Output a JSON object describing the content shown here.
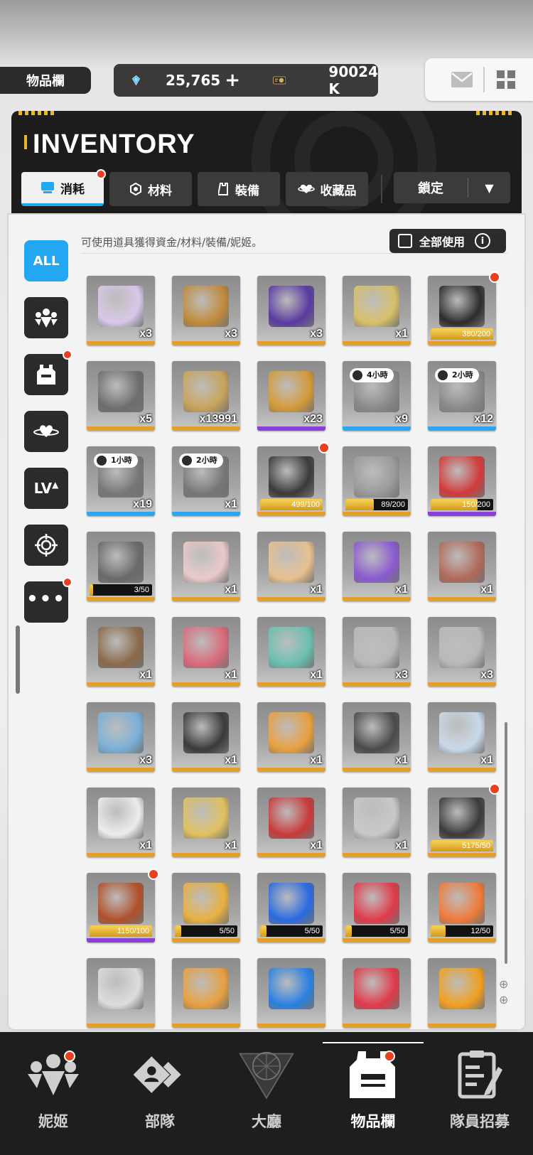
{
  "header": {
    "title": "物品欄",
    "gems": "25,765",
    "plus": "+",
    "credits": "90024 K"
  },
  "inventory": {
    "title": "INVENTORY",
    "tabs": [
      {
        "label": "消耗",
        "active": true,
        "badge": true
      },
      {
        "label": "材料",
        "active": false,
        "badge": false
      },
      {
        "label": "裝備",
        "active": false,
        "badge": false
      },
      {
        "label": "收藏品",
        "active": false,
        "badge": false
      }
    ],
    "lock_label": "鎖定"
  },
  "content": {
    "hint": "可使用道具獲得資金/材料/裝備/妮姬。",
    "use_all": "全部使用",
    "all_label": "ALL",
    "lv_label": "LV"
  },
  "items": [
    {
      "qty": "x3",
      "color": "#e3a02a",
      "art": "#d8c7e8"
    },
    {
      "qty": "x3",
      "color": "#e3a02a",
      "art": "#c08a3a"
    },
    {
      "qty": "x3",
      "color": "#e3a02a",
      "art": "#5a3aa0"
    },
    {
      "qty": "x1",
      "color": "#e3a02a",
      "art": "#d7bf6a"
    },
    {
      "progress": "380/200",
      "fill": 1.0,
      "color": "#e3a02a",
      "art": "#2c2c2c",
      "badge": true
    },
    {
      "qty": "x5",
      "color": "#e3a02a",
      "art": "#6e6e6e"
    },
    {
      "qty": "x13991",
      "color": "#e3a02a",
      "art": "#c9a35a"
    },
    {
      "qty": "x23",
      "color": "#8b3fd9",
      "art": "#d39a3a"
    },
    {
      "qty": "x9",
      "color": "#2aa7ef",
      "art": "#8a8a8a",
      "tag": "4小時"
    },
    {
      "qty": "x12",
      "color": "#2aa7ef",
      "art": "#8a8a8a",
      "tag": "2小時"
    },
    {
      "qty": "x19",
      "color": "#2aa7ef",
      "art": "#777",
      "tag": "1小時"
    },
    {
      "qty": "x1",
      "color": "#2aa7ef",
      "art": "#777",
      "tag": "2小時"
    },
    {
      "progress": "499/100",
      "fill": 1.0,
      "color": "#e3a02a",
      "art": "#3a3a3a",
      "badge": true
    },
    {
      "progress": "89/200",
      "fill": 0.45,
      "color": "#e3a02a",
      "art": "#9a9a9a"
    },
    {
      "progress": "150/200",
      "fill": 0.75,
      "color": "#8b3fd9",
      "art": "#d23a3a"
    },
    {
      "progress": "3/50",
      "fill": 0.06,
      "color": "#e3a02a",
      "art": "#6a6a6a"
    },
    {
      "qty": "x1",
      "color": "#e3a02a",
      "art": "#e9c9c9"
    },
    {
      "qty": "x1",
      "color": "#e3a02a",
      "art": "#e8c090"
    },
    {
      "qty": "x1",
      "color": "#e3a02a",
      "art": "#8a5ad0"
    },
    {
      "qty": "x1",
      "color": "#e3a02a",
      "art": "#b06a5a"
    },
    {
      "qty": "x1",
      "color": "#e3a02a",
      "art": "#8a6a4a"
    },
    {
      "qty": "x1",
      "color": "#e3a02a",
      "art": "#d96a7a"
    },
    {
      "qty": "x1",
      "color": "#e3a02a",
      "art": "#6ac0b0"
    },
    {
      "qty": "x3",
      "color": "#e3a02a",
      "art": "#b8b8b8"
    },
    {
      "qty": "x3",
      "color": "#e3a02a",
      "art": "#b8b8b8"
    },
    {
      "qty": "x3",
      "color": "#e3a02a",
      "art": "#7ab0d8"
    },
    {
      "qty": "x1",
      "color": "#e3a02a",
      "art": "#3a3a3a"
    },
    {
      "qty": "x1",
      "color": "#e3a02a",
      "art": "#e8a040"
    },
    {
      "qty": "x1",
      "color": "#e3a02a",
      "art": "#4a4a4a"
    },
    {
      "qty": "x1",
      "color": "#e3a02a",
      "art": "#c8d8e8"
    },
    {
      "qty": "x1",
      "color": "#e3a02a",
      "art": "#ececec"
    },
    {
      "qty": "x1",
      "color": "#e3a02a",
      "art": "#e0c060"
    },
    {
      "qty": "x1",
      "color": "#e3a02a",
      "art": "#c83a3a"
    },
    {
      "qty": "x1",
      "color": "#e3a02a",
      "art": "#c8c8c8"
    },
    {
      "progress": "5175/50",
      "fill": 1.0,
      "color": "#e3a02a",
      "art": "#3a3a3a",
      "badge": true
    },
    {
      "progress": "1150/100",
      "fill": 1.0,
      "color": "#8b3fd9",
      "art": "#b0502a",
      "badge": true
    },
    {
      "progress": "5/50",
      "fill": 0.1,
      "color": "#e3a02a",
      "art": "#e8b040"
    },
    {
      "progress": "5/50",
      "fill": 0.1,
      "color": "#e3a02a",
      "art": "#2a6ae0"
    },
    {
      "progress": "5/50",
      "fill": 0.1,
      "color": "#e3a02a",
      "art": "#e03a4a"
    },
    {
      "progress": "12/50",
      "fill": 0.24,
      "color": "#e3a02a",
      "art": "#f07a3a"
    },
    {
      "qty": "",
      "color": "#e3a02a",
      "art": "#dcdcdc"
    },
    {
      "qty": "",
      "color": "#e3a02a",
      "art": "#e8a040"
    },
    {
      "qty": "",
      "color": "#e3a02a",
      "art": "#2a80e0"
    },
    {
      "qty": "",
      "color": "#e3a02a",
      "art": "#e03a4a"
    },
    {
      "qty": "",
      "color": "#e3a02a",
      "art": "#f0a020"
    }
  ],
  "bottom_nav": [
    {
      "label": "妮姬",
      "badge": true,
      "active": false,
      "icon": "nikke-icon"
    },
    {
      "label": "部隊",
      "badge": false,
      "active": false,
      "icon": "squad-icon"
    },
    {
      "label": "大廳",
      "badge": false,
      "active": false,
      "icon": "lobby-icon"
    },
    {
      "label": "物品欄",
      "badge": true,
      "active": true,
      "icon": "inventory-icon"
    },
    {
      "label": "隊員招募",
      "badge": false,
      "active": false,
      "icon": "recruit-icon"
    }
  ],
  "colors": {
    "accent_blue": "#23a7f2",
    "badge_red": "#e8411f",
    "rarity_gold": "#e3a02a",
    "rarity_purple": "#8b3fd9",
    "rarity_blue": "#2aa7ef"
  }
}
